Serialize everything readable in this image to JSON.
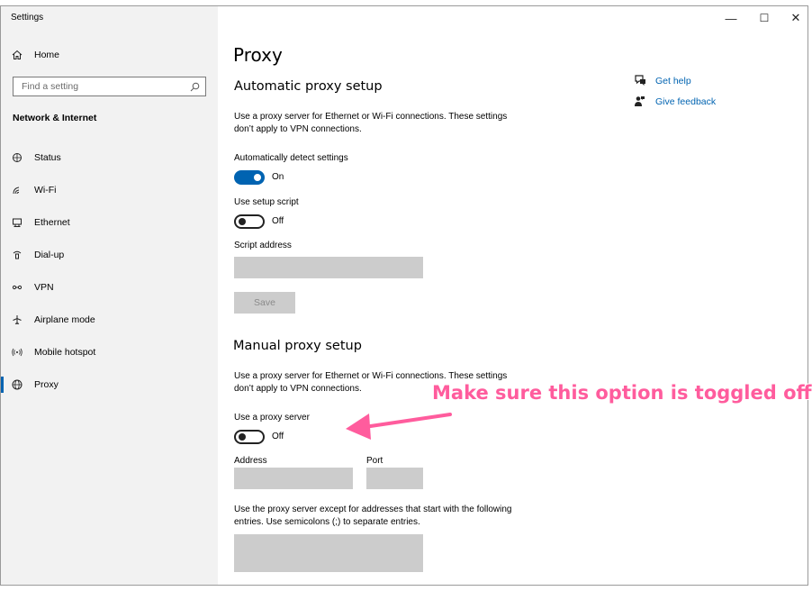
{
  "window": {
    "title": "Settings",
    "minimize": "—",
    "maximize": "☐",
    "close": "✕"
  },
  "sidebar": {
    "home": "Home",
    "search_placeholder": "Find a setting",
    "group": "Network & Internet",
    "items": [
      {
        "label": "Status",
        "icon": "status-icon"
      },
      {
        "label": "Wi-Fi",
        "icon": "wifi-icon"
      },
      {
        "label": "Ethernet",
        "icon": "ethernet-icon"
      },
      {
        "label": "Dial-up",
        "icon": "dialup-icon"
      },
      {
        "label": "VPN",
        "icon": "vpn-icon"
      },
      {
        "label": "Airplane mode",
        "icon": "airplane-icon"
      },
      {
        "label": "Mobile hotspot",
        "icon": "hotspot-icon"
      },
      {
        "label": "Proxy",
        "icon": "globe-icon"
      }
    ],
    "active": "Proxy"
  },
  "main": {
    "title": "Proxy",
    "auto": {
      "heading": "Automatic proxy setup",
      "desc_line1": "Use a proxy server for Ethernet or Wi-Fi connections. These settings",
      "desc_line2": "don’t apply to VPN connections.",
      "detect_label": "Automatically detect settings",
      "detect_state": "On",
      "script_label": "Use setup script",
      "script_state": "Off",
      "address_label": "Script address",
      "address_value": "",
      "save_label": "Save"
    },
    "manual": {
      "heading": "Manual proxy setup",
      "desc_line1": "Use a proxy server for Ethernet or Wi-Fi connections. These settings",
      "desc_line2": "don’t apply to VPN connections.",
      "proxy_label": "Use a proxy server",
      "proxy_state": "Off",
      "address_label": "Address",
      "address_value": "",
      "port_label": "Port",
      "port_value": "",
      "except_line1": "Use the proxy server except for addresses that start with the following",
      "except_line2": "entries. Use semicolons (;) to separate entries.",
      "except_value": ""
    },
    "help": {
      "get_help": "Get help",
      "give_feedback": "Give feedback"
    }
  },
  "annotation": {
    "text": "Make sure this option is toggled off",
    "color": "#ff5c9d"
  },
  "colors": {
    "accent": "#0063b1",
    "sidebar_bg": "#f2f2f2",
    "field_bg": "#cccccc"
  }
}
